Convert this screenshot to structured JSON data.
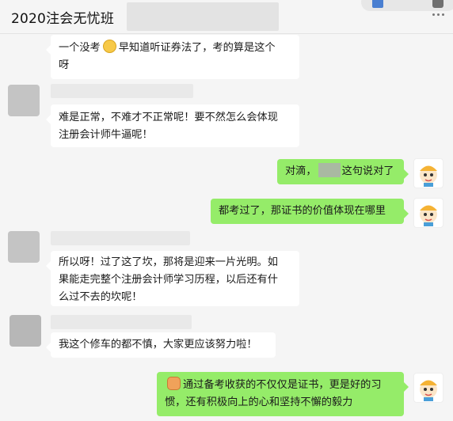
{
  "header": {
    "title": "2020注会无忧班"
  },
  "messages": [
    {
      "from": "other",
      "line1a": "一个没考",
      "line1b": "早知道听证券法了，考的算是这个",
      "line2": "呀",
      "emoji": "laughing-tears-icon"
    },
    {
      "from": "other",
      "line1": "难是正常，不难才不正常呢！要不然怎么会体现",
      "line2": "注册会计师牛逼呢！"
    },
    {
      "from": "self",
      "pre": "对滴，",
      "post": "这句说对了"
    },
    {
      "from": "self",
      "text": "都考过了，那证书的价值体现在哪里"
    },
    {
      "from": "other",
      "line1": "所以呀！过了这了坎，那将是迎来一片光明。如",
      "line2": "果能走完整个注册会计师学习历程，以后还有什",
      "line3": "么过不去的坎呢！"
    },
    {
      "from": "other",
      "text": "我这个修车的都不慎，大家更应该努力啦！"
    },
    {
      "from": "self",
      "line1": "通过备考收获的不仅仅是证书，更是好的习",
      "line2": "惯，还有积极向上的心和坚持不懈的毅力",
      "emoji": "raised-fist-icon"
    }
  ],
  "colors": {
    "self_bubble": "#95ec69",
    "other_bubble": "#ffffff",
    "background": "#f5f5f5"
  }
}
